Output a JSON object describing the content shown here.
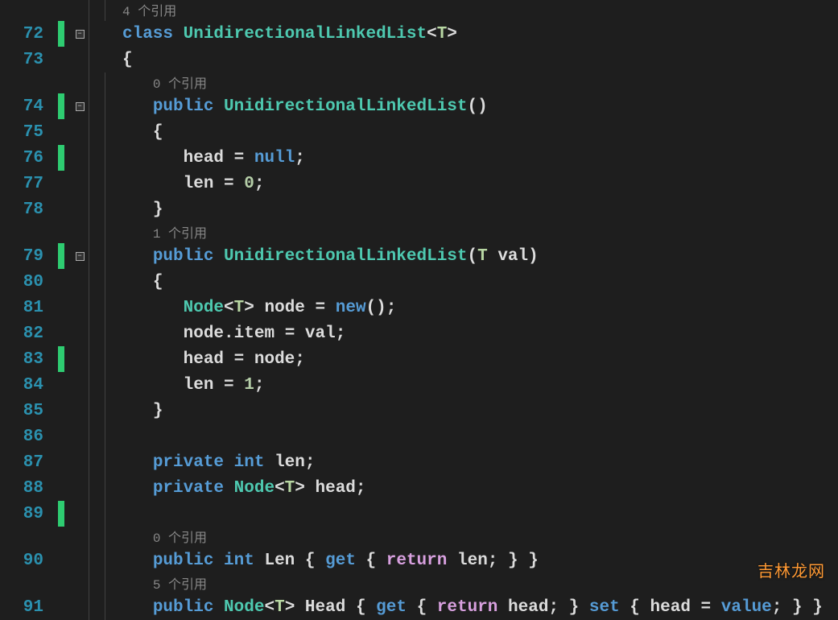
{
  "watermark": "吉林龙网",
  "lines": [
    {
      "ln": "",
      "change": false,
      "fold": false,
      "guides": 2,
      "codelens": true,
      "indent": 1,
      "tokens": [
        [
          "codelens",
          "4 个引用"
        ]
      ]
    },
    {
      "ln": "72",
      "change": true,
      "fold": true,
      "guides": 1,
      "codelens": false,
      "indent": 1,
      "tokens": [
        [
          "kw",
          "class"
        ],
        [
          "sp",
          " "
        ],
        [
          "type",
          "UnidirectionalLinkedList"
        ],
        [
          "punc",
          "<"
        ],
        [
          "tparam",
          "T"
        ],
        [
          "punc",
          ">"
        ]
      ]
    },
    {
      "ln": "73",
      "change": false,
      "fold": false,
      "guides": 1,
      "codelens": false,
      "indent": 1,
      "tokens": [
        [
          "punc",
          "{"
        ]
      ]
    },
    {
      "ln": "",
      "change": false,
      "fold": false,
      "guides": 2,
      "codelens": true,
      "indent": 2,
      "tokens": [
        [
          "codelens",
          "0 个引用"
        ]
      ]
    },
    {
      "ln": "74",
      "change": true,
      "fold": true,
      "guides": 2,
      "codelens": false,
      "indent": 2,
      "tokens": [
        [
          "kw",
          "public"
        ],
        [
          "sp",
          " "
        ],
        [
          "type",
          "UnidirectionalLinkedList"
        ],
        [
          "punc",
          "()"
        ]
      ]
    },
    {
      "ln": "75",
      "change": false,
      "fold": false,
      "guides": 2,
      "codelens": false,
      "indent": 2,
      "tokens": [
        [
          "punc",
          "{"
        ]
      ]
    },
    {
      "ln": "76",
      "change": true,
      "fold": false,
      "guides": 2,
      "codelens": false,
      "indent": 3,
      "tokens": [
        [
          "id",
          "head"
        ],
        [
          "sp",
          " "
        ],
        [
          "punc",
          "="
        ],
        [
          "sp",
          " "
        ],
        [
          "kw",
          "null"
        ],
        [
          "punc",
          ";"
        ]
      ]
    },
    {
      "ln": "77",
      "change": false,
      "fold": false,
      "guides": 2,
      "codelens": false,
      "indent": 3,
      "tokens": [
        [
          "id",
          "len"
        ],
        [
          "sp",
          " "
        ],
        [
          "punc",
          "="
        ],
        [
          "sp",
          " "
        ],
        [
          "num",
          "0"
        ],
        [
          "punc",
          ";"
        ]
      ]
    },
    {
      "ln": "78",
      "change": false,
      "fold": false,
      "guides": 2,
      "codelens": false,
      "indent": 2,
      "tokens": [
        [
          "punc",
          "}"
        ]
      ]
    },
    {
      "ln": "",
      "change": false,
      "fold": false,
      "guides": 2,
      "codelens": true,
      "indent": 2,
      "tokens": [
        [
          "codelens",
          "1 个引用"
        ]
      ]
    },
    {
      "ln": "79",
      "change": true,
      "fold": true,
      "guides": 2,
      "codelens": false,
      "indent": 2,
      "tokens": [
        [
          "kw",
          "public"
        ],
        [
          "sp",
          " "
        ],
        [
          "type",
          "UnidirectionalLinkedList"
        ],
        [
          "punc",
          "("
        ],
        [
          "tparam",
          "T"
        ],
        [
          "sp",
          " "
        ],
        [
          "id",
          "val"
        ],
        [
          "punc",
          ")"
        ]
      ]
    },
    {
      "ln": "80",
      "change": false,
      "fold": false,
      "guides": 2,
      "codelens": false,
      "indent": 2,
      "tokens": [
        [
          "punc",
          "{"
        ]
      ]
    },
    {
      "ln": "81",
      "change": false,
      "fold": false,
      "guides": 2,
      "codelens": false,
      "indent": 3,
      "tokens": [
        [
          "type",
          "Node"
        ],
        [
          "punc",
          "<"
        ],
        [
          "tparam",
          "T"
        ],
        [
          "punc",
          ">"
        ],
        [
          "sp",
          " "
        ],
        [
          "id",
          "node"
        ],
        [
          "sp",
          " "
        ],
        [
          "punc",
          "="
        ],
        [
          "sp",
          " "
        ],
        [
          "kw",
          "new"
        ],
        [
          "punc",
          "();"
        ]
      ]
    },
    {
      "ln": "82",
      "change": false,
      "fold": false,
      "guides": 2,
      "codelens": false,
      "indent": 3,
      "tokens": [
        [
          "id",
          "node"
        ],
        [
          "punc",
          "."
        ],
        [
          "id",
          "item"
        ],
        [
          "sp",
          " "
        ],
        [
          "punc",
          "="
        ],
        [
          "sp",
          " "
        ],
        [
          "id",
          "val"
        ],
        [
          "punc",
          ";"
        ]
      ]
    },
    {
      "ln": "83",
      "change": true,
      "fold": false,
      "guides": 2,
      "codelens": false,
      "indent": 3,
      "tokens": [
        [
          "id",
          "head"
        ],
        [
          "sp",
          " "
        ],
        [
          "punc",
          "="
        ],
        [
          "sp",
          " "
        ],
        [
          "id",
          "node"
        ],
        [
          "punc",
          ";"
        ]
      ]
    },
    {
      "ln": "84",
      "change": false,
      "fold": false,
      "guides": 2,
      "codelens": false,
      "indent": 3,
      "tokens": [
        [
          "id",
          "len"
        ],
        [
          "sp",
          " "
        ],
        [
          "punc",
          "="
        ],
        [
          "sp",
          " "
        ],
        [
          "num",
          "1"
        ],
        [
          "punc",
          ";"
        ]
      ]
    },
    {
      "ln": "85",
      "change": false,
      "fold": false,
      "guides": 2,
      "codelens": false,
      "indent": 2,
      "tokens": [
        [
          "punc",
          "}"
        ]
      ]
    },
    {
      "ln": "86",
      "change": false,
      "fold": false,
      "guides": 2,
      "codelens": false,
      "indent": 0,
      "tokens": []
    },
    {
      "ln": "87",
      "change": false,
      "fold": false,
      "guides": 2,
      "codelens": false,
      "indent": 2,
      "tokens": [
        [
          "kw",
          "private"
        ],
        [
          "sp",
          " "
        ],
        [
          "kw",
          "int"
        ],
        [
          "sp",
          " "
        ],
        [
          "id",
          "len"
        ],
        [
          "punc",
          ";"
        ]
      ]
    },
    {
      "ln": "88",
      "change": false,
      "fold": false,
      "guides": 2,
      "codelens": false,
      "indent": 2,
      "tokens": [
        [
          "kw",
          "private"
        ],
        [
          "sp",
          " "
        ],
        [
          "type",
          "Node"
        ],
        [
          "punc",
          "<"
        ],
        [
          "tparam",
          "T"
        ],
        [
          "punc",
          ">"
        ],
        [
          "sp",
          " "
        ],
        [
          "id",
          "head"
        ],
        [
          "punc",
          ";"
        ]
      ]
    },
    {
      "ln": "89",
      "change": true,
      "fold": false,
      "guides": 2,
      "codelens": false,
      "indent": 0,
      "tokens": []
    },
    {
      "ln": "",
      "change": false,
      "fold": false,
      "guides": 2,
      "codelens": true,
      "indent": 2,
      "tokens": [
        [
          "codelens",
          "0 个引用"
        ]
      ]
    },
    {
      "ln": "90",
      "change": false,
      "fold": false,
      "guides": 2,
      "codelens": false,
      "indent": 2,
      "tokens": [
        [
          "kw",
          "public"
        ],
        [
          "sp",
          " "
        ],
        [
          "kw",
          "int"
        ],
        [
          "sp",
          " "
        ],
        [
          "id",
          "Len"
        ],
        [
          "sp",
          " "
        ],
        [
          "punc",
          "{"
        ],
        [
          "sp",
          " "
        ],
        [
          "kw",
          "get"
        ],
        [
          "sp",
          " "
        ],
        [
          "punc",
          "{"
        ],
        [
          "sp",
          " "
        ],
        [
          "ctrl",
          "return"
        ],
        [
          "sp",
          " "
        ],
        [
          "id",
          "len"
        ],
        [
          "punc",
          "; } }"
        ]
      ]
    },
    {
      "ln": "",
      "change": false,
      "fold": false,
      "guides": 2,
      "codelens": true,
      "indent": 2,
      "tokens": [
        [
          "codelens",
          "5 个引用"
        ]
      ]
    },
    {
      "ln": "91",
      "change": false,
      "fold": false,
      "guides": 2,
      "codelens": false,
      "indent": 2,
      "tokens": [
        [
          "kw",
          "public"
        ],
        [
          "sp",
          " "
        ],
        [
          "type",
          "Node"
        ],
        [
          "punc",
          "<"
        ],
        [
          "tparam",
          "T"
        ],
        [
          "punc",
          ">"
        ],
        [
          "sp",
          " "
        ],
        [
          "id",
          "Head"
        ],
        [
          "sp",
          " "
        ],
        [
          "punc",
          "{"
        ],
        [
          "sp",
          " "
        ],
        [
          "kw",
          "get"
        ],
        [
          "sp",
          " "
        ],
        [
          "punc",
          "{"
        ],
        [
          "sp",
          " "
        ],
        [
          "ctrl",
          "return"
        ],
        [
          "sp",
          " "
        ],
        [
          "id",
          "head"
        ],
        [
          "punc",
          "; }"
        ],
        [
          "sp",
          " "
        ],
        [
          "kw",
          "set"
        ],
        [
          "sp",
          " "
        ],
        [
          "punc",
          "{"
        ],
        [
          "sp",
          " "
        ],
        [
          "id",
          "head"
        ],
        [
          "sp",
          " "
        ],
        [
          "punc",
          "="
        ],
        [
          "sp",
          " "
        ],
        [
          "kw",
          "value"
        ],
        [
          "punc",
          "; } }"
        ]
      ]
    }
  ]
}
